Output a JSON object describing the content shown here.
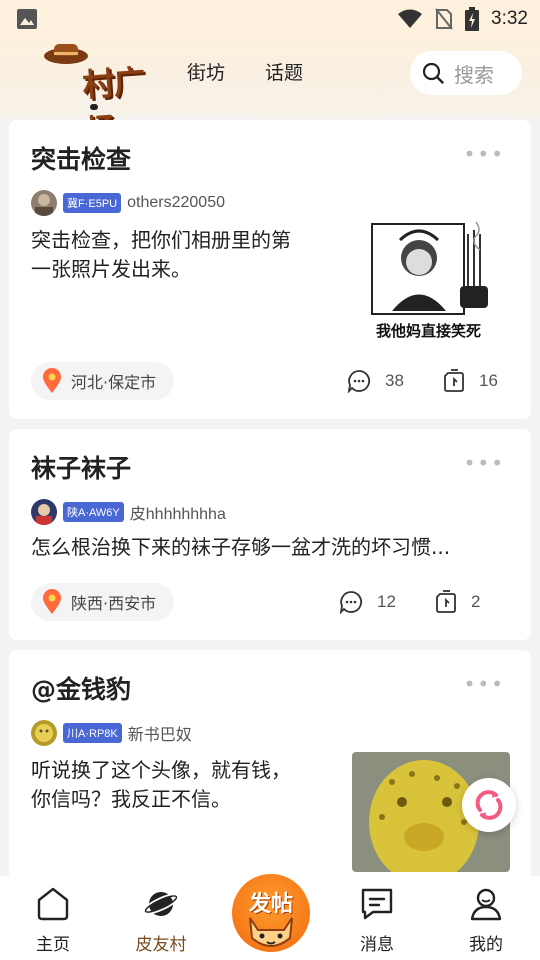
{
  "status_bar": {
    "time": "3:32"
  },
  "header": {
    "logo_text": "村广场",
    "tabs": [
      {
        "label": "街坊"
      },
      {
        "label": "话题"
      }
    ],
    "search_placeholder": "搜索"
  },
  "posts": [
    {
      "title": "突击检查",
      "plate": "冀F·E5PU",
      "username": "others220050",
      "text_lines": [
        "突击检查，把你们相册里的第",
        "一张照片发出来。"
      ],
      "image_caption": "我他妈直接笑死",
      "location": "河北·保定市",
      "comments": "38",
      "shares": "16"
    },
    {
      "title": "袜子袜子",
      "plate": "陕A·AW6Y",
      "username": "皮hhhhhhhha",
      "text_lines": [
        "怎么根治换下来的袜子存够一盆才洗的坏习惯..."
      ],
      "location": "陕西·西安市",
      "comments": "12",
      "shares": "2"
    },
    {
      "title": "@金钱豹",
      "plate": "川A·RP8K",
      "username": "新书巴奴",
      "text_lines": [
        "听说换了这个头像，就有钱，",
        "你信吗？我反正不信。"
      ]
    }
  ],
  "bottom_nav": {
    "items": [
      {
        "label": "主页"
      },
      {
        "label": "皮友村"
      },
      {
        "label": "消息"
      },
      {
        "label": "我的"
      }
    ],
    "post_button": "发帖"
  },
  "colors": {
    "accent": "#f26b10",
    "plate": "#4a67d6",
    "active_nav": "#7a4a1e"
  }
}
